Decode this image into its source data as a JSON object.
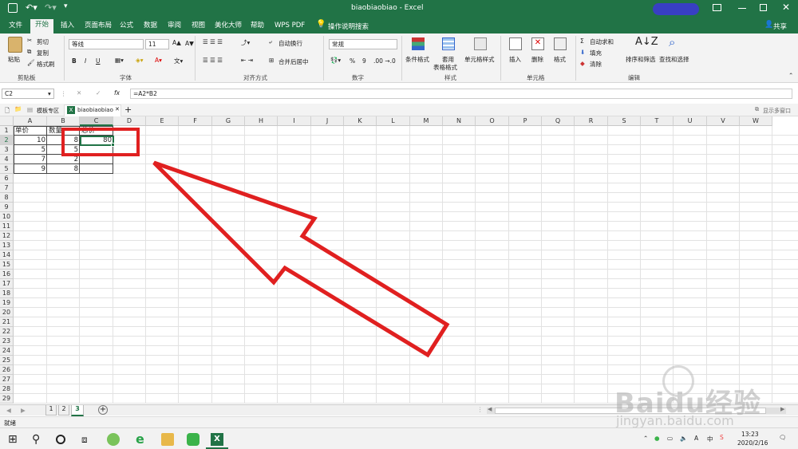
{
  "window": {
    "title": "biaobiaobiao - Excel",
    "share_label": "共享"
  },
  "tabs": [
    "文件",
    "开始",
    "插入",
    "页面布局",
    "公式",
    "数据",
    "审阅",
    "视图",
    "美化大师",
    "帮助",
    "WPS PDF"
  ],
  "tell_me": "操作说明搜索",
  "ribbon": {
    "clipboard": {
      "paste": "粘贴",
      "cut": "剪切",
      "copy": "复制",
      "format_painter": "格式刷",
      "label": "剪贴板"
    },
    "font": {
      "name": "等线",
      "size": "11",
      "bold": "B",
      "italic": "I",
      "underline": "U",
      "label": "字体"
    },
    "alignment": {
      "wrap": "自动换行",
      "merge": "合并后居中",
      "label": "对齐方式"
    },
    "number": {
      "format": "常规",
      "percent": "%",
      "comma": "9",
      "label": "数字"
    },
    "styles": {
      "conditional": "条件格式",
      "table_fmt_1": "套用",
      "table_fmt_2": "表格格式",
      "cell_styles": "单元格样式",
      "label": "样式"
    },
    "cells": {
      "insert": "插入",
      "delete": "删除",
      "format": "格式",
      "label": "单元格"
    },
    "editing": {
      "autosum": "自动求和",
      "fill": "填充",
      "clear": "清除",
      "sort": "排序和筛选",
      "find": "查找和选择",
      "label": "编辑"
    }
  },
  "formula_bar": {
    "name_box": "C2",
    "fx": "fx",
    "formula": "=A2*B2"
  },
  "doc_tabs": {
    "template": "模板专区",
    "file": "biaobiaobiao",
    "multi_window": "显示多窗口"
  },
  "columns": [
    "A",
    "B",
    "C",
    "D",
    "E",
    "F",
    "G",
    "H",
    "I",
    "J",
    "K",
    "L",
    "M",
    "N",
    "O",
    "P",
    "Q",
    "R",
    "S",
    "T",
    "U",
    "V",
    "W"
  ],
  "rows": [
    "1",
    "2",
    "3",
    "4",
    "5",
    "6",
    "7",
    "8",
    "9",
    "10",
    "11",
    "12",
    "13",
    "14",
    "15",
    "16",
    "17",
    "18",
    "19",
    "20",
    "21",
    "22",
    "23",
    "24",
    "25",
    "26",
    "27",
    "28",
    "29"
  ],
  "cells": {
    "A1": "单价",
    "B1": "数量",
    "C1": "总价",
    "A2": "10",
    "B2": "8",
    "C2": "80",
    "A3": "5",
    "B3": "5",
    "A4": "7",
    "B4": "2",
    "A5": "9",
    "B5": "8"
  },
  "sheets": [
    "1",
    "2",
    "3"
  ],
  "active_sheet": "3",
  "status": {
    "ready": "就绪"
  },
  "clock": {
    "time": "13:23",
    "date": "2020/2/16"
  },
  "tray": {
    "ime": "中",
    "font_icon": "A"
  },
  "watermark": {
    "logo": "Baidu经验",
    "url": "jingyan.baidu.com"
  },
  "colors": {
    "excel_green": "#217346",
    "annotation_red": "#e02020"
  }
}
